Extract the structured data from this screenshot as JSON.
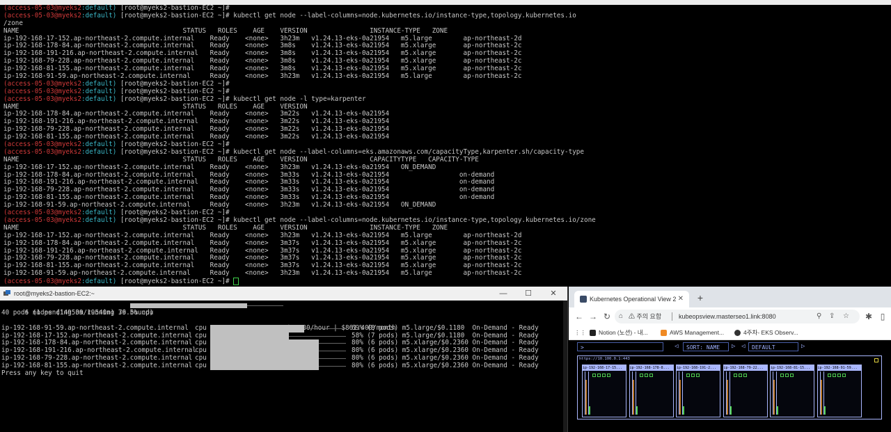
{
  "terminal_top": {
    "lines": [
      [
        {
          "t": "(access-05-03@myeks2",
          "c": "red"
        },
        {
          "t": ":default)",
          "c": "cyan"
        },
        {
          "t": " [root@myeks2-bastion-EC2 ~]#",
          "c": "w"
        }
      ],
      [
        {
          "t": "(access-05-03@myeks2",
          "c": "red"
        },
        {
          "t": ":default)",
          "c": "cyan"
        },
        {
          "t": " [root@myeks2-bastion-EC2 ~]# kubectl get node --label-columns=node.kubernetes.io/instance-type,topology.kubernetes.io",
          "c": "w"
        }
      ],
      [
        {
          "t": "/zone",
          "c": "w"
        }
      ],
      [
        {
          "t": "NAME                                          STATUS   ROLES    AGE    VERSION                INSTANCE-TYPE   ZONE",
          "c": "w"
        }
      ],
      [
        {
          "t": "ip-192-168-17-152.ap-northeast-2.compute.internal    Ready    <none>   3h23m   v1.24.13-eks-0a21954   m5.large        ap-northeast-2d",
          "c": "w"
        }
      ],
      [
        {
          "t": "ip-192-168-178-84.ap-northeast-2.compute.internal    Ready    <none>   3m8s    v1.24.13-eks-0a21954   m5.xlarge       ap-northeast-2c",
          "c": "w"
        }
      ],
      [
        {
          "t": "ip-192-168-191-216.ap-northeast-2.compute.internal   Ready    <none>   3m8s    v1.24.13-eks-0a21954   m5.xlarge       ap-northeast-2c",
          "c": "w"
        }
      ],
      [
        {
          "t": "ip-192-168-79-228.ap-northeast-2.compute.internal    Ready    <none>   3m8s    v1.24.13-eks-0a21954   m5.xlarge       ap-northeast-2c",
          "c": "w"
        }
      ],
      [
        {
          "t": "ip-192-168-81-155.ap-northeast-2.compute.internal    Ready    <none>   3m8s    v1.24.13-eks-0a21954   m5.xlarge       ap-northeast-2c",
          "c": "w"
        }
      ],
      [
        {
          "t": "ip-192-168-91-59.ap-northeast-2.compute.internal     Ready    <none>   3h23m   v1.24.13-eks-0a21954   m5.large        ap-northeast-2c",
          "c": "w"
        }
      ],
      [
        {
          "t": "(access-05-03@myeks2",
          "c": "red"
        },
        {
          "t": ":default)",
          "c": "cyan"
        },
        {
          "t": " [root@myeks2-bastion-EC2 ~]#",
          "c": "w"
        }
      ],
      [
        {
          "t": "(access-05-03@myeks2",
          "c": "red"
        },
        {
          "t": ":default)",
          "c": "cyan"
        },
        {
          "t": " [root@myeks2-bastion-EC2 ~]#",
          "c": "w"
        }
      ],
      [
        {
          "t": "(access-05-03@myeks2",
          "c": "red"
        },
        {
          "t": ":default)",
          "c": "cyan"
        },
        {
          "t": " [root@myeks2-bastion-EC2 ~]# kubectl get node -l type=karpenter",
          "c": "w"
        }
      ],
      [
        {
          "t": "NAME                                          STATUS   ROLES    AGE    VERSION",
          "c": "w"
        }
      ],
      [
        {
          "t": "ip-192-168-178-84.ap-northeast-2.compute.internal    Ready    <none>   3m22s   v1.24.13-eks-0a21954",
          "c": "w"
        }
      ],
      [
        {
          "t": "ip-192-168-191-216.ap-northeast-2.compute.internal   Ready    <none>   3m22s   v1.24.13-eks-0a21954",
          "c": "w"
        }
      ],
      [
        {
          "t": "ip-192-168-79-228.ap-northeast-2.compute.internal    Ready    <none>   3m22s   v1.24.13-eks-0a21954",
          "c": "w"
        }
      ],
      [
        {
          "t": "ip-192-168-81-155.ap-northeast-2.compute.internal    Ready    <none>   3m22s   v1.24.13-eks-0a21954",
          "c": "w"
        }
      ],
      [
        {
          "t": "(access-05-03@myeks2",
          "c": "red"
        },
        {
          "t": ":default)",
          "c": "cyan"
        },
        {
          "t": " [root@myeks2-bastion-EC2 ~]#",
          "c": "w"
        }
      ],
      [
        {
          "t": "(access-05-03@myeks2",
          "c": "red"
        },
        {
          "t": ":default)",
          "c": "cyan"
        },
        {
          "t": " [root@myeks2-bastion-EC2 ~]# kubectl get node --label-columns=eks.amazonaws.com/capacityType,karpenter.sh/capacity-type",
          "c": "w"
        }
      ],
      [
        {
          "t": "NAME                                          STATUS   ROLES    AGE    VERSION                CAPACITYTYPE   CAPACITY-TYPE",
          "c": "w"
        }
      ],
      [
        {
          "t": "ip-192-168-17-152.ap-northeast-2.compute.internal    Ready    <none>   3h23m   v1.24.13-eks-0a21954   ON_DEMAND",
          "c": "w"
        }
      ],
      [
        {
          "t": "ip-192-168-178-84.ap-northeast-2.compute.internal    Ready    <none>   3m33s   v1.24.13-eks-0a21954                  on-demand",
          "c": "w"
        }
      ],
      [
        {
          "t": "ip-192-168-191-216.ap-northeast-2.compute.internal   Ready    <none>   3m33s   v1.24.13-eks-0a21954                  on-demand",
          "c": "w"
        }
      ],
      [
        {
          "t": "ip-192-168-79-228.ap-northeast-2.compute.internal    Ready    <none>   3m33s   v1.24.13-eks-0a21954                  on-demand",
          "c": "w"
        }
      ],
      [
        {
          "t": "ip-192-168-81-155.ap-northeast-2.compute.internal    Ready    <none>   3m33s   v1.24.13-eks-0a21954                  on-demand",
          "c": "w"
        }
      ],
      [
        {
          "t": "ip-192-168-91-59.ap-northeast-2.compute.internal     Ready    <none>   3h23m   v1.24.13-eks-0a21954   ON_DEMAND",
          "c": "w"
        }
      ],
      [
        {
          "t": "(access-05-03@myeks2",
          "c": "red"
        },
        {
          "t": ":default)",
          "c": "cyan"
        },
        {
          "t": " [root@myeks2-bastion-EC2 ~]#",
          "c": "w"
        }
      ],
      [
        {
          "t": "(access-05-03@myeks2",
          "c": "red"
        },
        {
          "t": ":default)",
          "c": "cyan"
        },
        {
          "t": " [root@myeks2-bastion-EC2 ~]# kubectl get node --label-columns=node.kubernetes.io/instance-type,topology.kubernetes.io/zone",
          "c": "w"
        }
      ],
      [
        {
          "t": "NAME                                          STATUS   ROLES    AGE    VERSION                INSTANCE-TYPE   ZONE",
          "c": "w"
        }
      ],
      [
        {
          "t": "ip-192-168-17-152.ap-northeast-2.compute.internal    Ready    <none>   3h23m   v1.24.13-eks-0a21954   m5.large        ap-northeast-2d",
          "c": "w"
        }
      ],
      [
        {
          "t": "ip-192-168-178-84.ap-northeast-2.compute.internal    Ready    <none>   3m37s   v1.24.13-eks-0a21954   m5.xlarge       ap-northeast-2c",
          "c": "w"
        }
      ],
      [
        {
          "t": "ip-192-168-191-216.ap-northeast-2.compute.internal   Ready    <none>   3m37s   v1.24.13-eks-0a21954   m5.xlarge       ap-northeast-2c",
          "c": "w"
        }
      ],
      [
        {
          "t": "ip-192-168-79-228.ap-northeast-2.compute.internal    Ready    <none>   3m37s   v1.24.13-eks-0a21954   m5.xlarge       ap-northeast-2c",
          "c": "w"
        }
      ],
      [
        {
          "t": "ip-192-168-81-155.ap-northeast-2.compute.internal    Ready    <none>   3m37s   v1.24.13-eks-0a21954   m5.xlarge       ap-northeast-2c",
          "c": "w"
        }
      ],
      [
        {
          "t": "ip-192-168-91-59.ap-northeast-2.compute.internal     Ready    <none>   3h23m   v1.24.13-eks-0a21954   m5.large        ap-northeast-2c",
          "c": "w"
        }
      ],
      [
        {
          "t": "(access-05-03@myeks2",
          "c": "red"
        },
        {
          "t": ":default)",
          "c": "cyan"
        },
        {
          "t": " [root@myeks2-bastion-EC2 ~]# ",
          "c": "w"
        }
      ]
    ]
  },
  "terminal_bottom": {
    "title": "root@myeks2-bastion-EC2:~",
    "summary": "6 nodes (14950m/19540m) 76.5% cpu",
    "summary_fill": 0.765,
    "summary_cost": "$1.180/hour | $861.400/month",
    "pods_line": "40 pods (1 pending 39 running 39 bound)",
    "nodes": [
      {
        "name": "ip-192-168-91-59.ap-northeast-2.compute.internal",
        "res": "cpu",
        "pct": 69,
        "info": "69% (8 pods) m5.large/$0.1180  On-Demand - Ready"
      },
      {
        "name": "ip-192-168-17-152.ap-northeast-2.compute.internal",
        "res": "cpu",
        "pct": 58,
        "info": "58% (7 pods) m5.large/$0.1180  On-Demand - Ready"
      },
      {
        "name": "ip-192-168-178-84.ap-northeast-2.compute.internal",
        "res": "cpu",
        "pct": 80,
        "info": "80% (6 pods) m5.xlarge/$0.2360 On-Demand - Ready"
      },
      {
        "name": "ip-192-168-191-216.ap-northeast-2.compute.internal",
        "res": "cpu",
        "pct": 80,
        "info": "80% (6 pods) m5.xlarge/$0.2360 On-Demand - Ready"
      },
      {
        "name": "ip-192-168-79-228.ap-northeast-2.compute.internal",
        "res": "cpu",
        "pct": 80,
        "info": "80% (6 pods) m5.xlarge/$0.2360 On-Demand - Ready"
      },
      {
        "name": "ip-192-168-81-155.ap-northeast-2.compute.internal",
        "res": "cpu",
        "pct": 80,
        "info": "80% (6 pods) m5.xlarge/$0.2360 On-Demand - Ready"
      }
    ],
    "footer": "Press any key to quit",
    "controls": {
      "minimize": "—",
      "maximize": "☐",
      "close": "✕"
    }
  },
  "browser": {
    "tab_title": "Kubernetes Operational View 2",
    "tab_close": "✕",
    "new_tab": "+",
    "warning": "⚠ 주의 요함",
    "url": "kubeopsview.masterseo1.link:8080",
    "bookmarks": [
      "Notion (노션) - 내...",
      "AWS Management...",
      "4주차- EKS Observ..."
    ],
    "kov": {
      "filter_prompt": ">",
      "sort_label": "SORT: NAME",
      "namespace_label": "DEFAULT",
      "cluster_label": "https://10.100.0.1:443",
      "nodes": [
        {
          "label": "ip-192-168-17-15...",
          "pods": 4
        },
        {
          "label": "ip-192-168-178-8...",
          "pods": 3
        },
        {
          "label": "ip-192-168-191-2...",
          "pods": 3
        },
        {
          "label": "ip-192-168-79-22...",
          "pods": 3
        },
        {
          "label": "ip-192-168-81-15...",
          "pods": 3
        },
        {
          "label": "ip-192-168-91-59...",
          "pods": 4
        }
      ]
    }
  }
}
